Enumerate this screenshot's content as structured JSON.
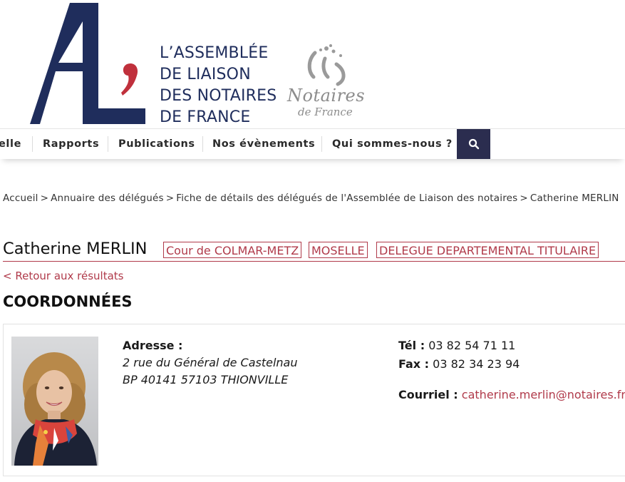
{
  "header": {
    "logo_lines": [
      "L’ASSEMBLÉE",
      "DE LIAISON",
      "DES NOTAIRES",
      "DE FRANCE"
    ],
    "partner_logo_word": "Notaires",
    "partner_logo_sub": "de France",
    "brand_color": "#1f2d5c",
    "accent_color": "#b03a4a"
  },
  "nav": {
    "items": [
      {
        "label": "elle"
      },
      {
        "label": "Rapports"
      },
      {
        "label": "Publications"
      },
      {
        "label": "Nos évènements"
      },
      {
        "label": "Qui sommes-nous ?"
      }
    ],
    "search_icon": "search-icon",
    "search_bg": "#2b2d4f"
  },
  "breadcrumb": {
    "items": [
      "Accueil",
      "Annuaire des délégués",
      "Fiche de détails des délégués de l'Assemblée de Liaison des notaires",
      "Catherine MERLIN"
    ],
    "separator": ">"
  },
  "profile": {
    "name": "Catherine MERLIN",
    "tags": [
      "Cour de COLMAR-METZ",
      "MOSELLE",
      "DELEGUE DEPARTEMENTAL TITULAIRE"
    ],
    "back_link": "< Retour aux résultats",
    "section_title": "COORDONNÉES",
    "address_label": "Adresse :",
    "address_lines": [
      "2 rue du Général de Castelnau",
      "BP 40141 57103 THIONVILLE"
    ],
    "tel_label": "Tél :",
    "tel": "03 82 54 71 11",
    "fax_label": "Fax :",
    "fax": "03 82 34 23 94",
    "email_label": "Courriel :",
    "email": "catherine.merlin@notaires.fr"
  }
}
